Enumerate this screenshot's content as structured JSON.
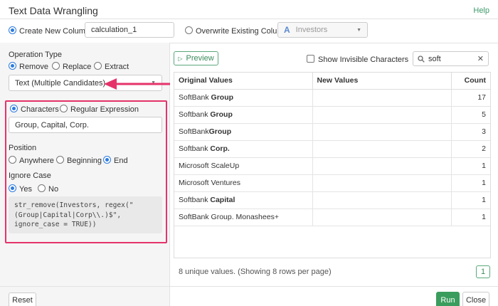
{
  "header": {
    "title": "Text Data Wrangling",
    "help": "Help"
  },
  "target": {
    "create_label": "Create New Column",
    "new_column_name": "calculation_1",
    "overwrite_label": "Overwrite Existing Column",
    "column_type_icon": "A",
    "existing_column": "Investors"
  },
  "operation": {
    "title": "Operation Type",
    "options": [
      "Remove",
      "Replace",
      "Extract"
    ],
    "selected": "Remove",
    "mode": "Text (Multiple Candidates)"
  },
  "match": {
    "characters_label": "Characters",
    "regex_label": "Regular Expression",
    "value": "Group, Capital, Corp."
  },
  "position": {
    "title": "Position",
    "options": [
      "Anywhere",
      "Beginning",
      "End"
    ],
    "selected": "End"
  },
  "ignore_case": {
    "title": "Ignore Case",
    "options": [
      "Yes",
      "No"
    ],
    "selected": "Yes"
  },
  "code": "str_remove(Investors, regex(\"\n(Group|Capital|Corp\\\\.)$\",\nignore_case = TRUE))",
  "preview": {
    "button": "Preview",
    "show_invisible_label": "Show Invisible Characters",
    "search_value": "soft",
    "columns": [
      "Original Values",
      "New Values",
      "Count"
    ],
    "rows": [
      {
        "pre": "SoftBank ",
        "bold": "Group",
        "post": "",
        "new": "",
        "count": "17"
      },
      {
        "pre": "Softbank ",
        "bold": "Group",
        "post": "",
        "new": "",
        "count": "5"
      },
      {
        "pre": "SoftBank",
        "bold": "Group",
        "post": "",
        "new": "",
        "count": "3"
      },
      {
        "pre": "Softbank ",
        "bold": "Corp.",
        "post": "",
        "new": "",
        "count": "2"
      },
      {
        "pre": "Microsoft ScaleUp",
        "bold": "",
        "post": "",
        "new": "",
        "count": "1"
      },
      {
        "pre": "Microsoft Ventures",
        "bold": "",
        "post": "",
        "new": "",
        "count": "1"
      },
      {
        "pre": "Softbank ",
        "bold": "Capital",
        "post": "",
        "new": "",
        "count": "1"
      },
      {
        "pre": "SoftBank Group. Monashees+",
        "bold": "",
        "post": "",
        "new": "",
        "count": "1"
      }
    ],
    "summary": "8 unique values. (Showing 8 rows per page)",
    "page": "1"
  },
  "footer": {
    "reset": "Reset",
    "run": "Run",
    "close": "Close"
  },
  "colors": {
    "accent": "#2d7be0",
    "green": "#3a9d5d",
    "highlight": "#e5336a"
  }
}
